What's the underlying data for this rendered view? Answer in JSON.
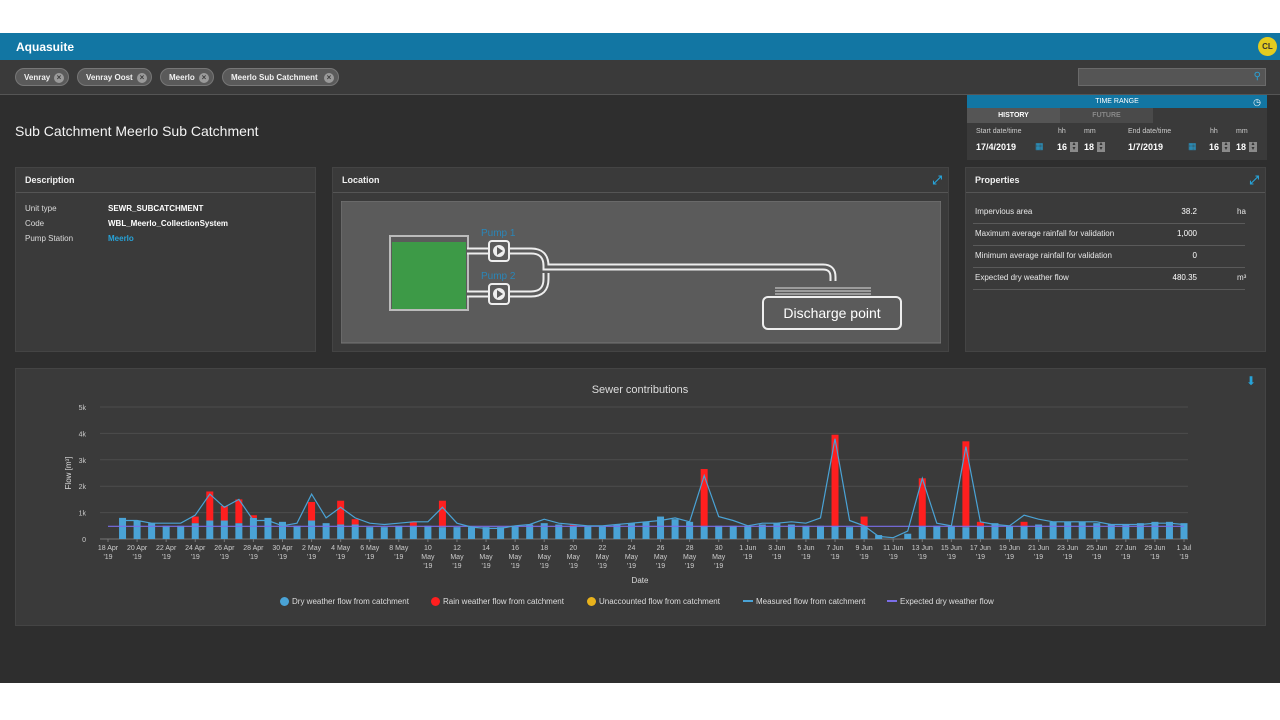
{
  "app": {
    "title": "Aquasuite",
    "user_initials": "CL"
  },
  "filters": [
    {
      "label": "Venray"
    },
    {
      "label": "Venray Oost"
    },
    {
      "label": "Meerlo"
    },
    {
      "label": "Meerlo Sub Catchment"
    }
  ],
  "search": {
    "placeholder": ""
  },
  "page": {
    "title": "Sub Catchment Meerlo Sub Catchment"
  },
  "time_range": {
    "title": "TIME RANGE",
    "tabs": [
      "HISTORY",
      "FUTURE"
    ],
    "active_tab": "HISTORY",
    "start_label": "Start date/time",
    "end_label": "End date/time",
    "hh_label": "hh",
    "mm_label": "mm",
    "start_date": "17/4/2019",
    "start_hh": "16",
    "start_mm": "18",
    "end_date": "1/7/2019",
    "end_hh": "16",
    "end_mm": "18"
  },
  "description": {
    "title": "Description",
    "rows": [
      {
        "key": "Unit type",
        "value": "SEWR_SUBCATCHMENT"
      },
      {
        "key": "Code",
        "value": "WBL_Meerlo_CollectionSystem"
      },
      {
        "key": "Pump Station",
        "value": "Meerlo"
      }
    ]
  },
  "location": {
    "title": "Location",
    "pump1": "Pump 1",
    "pump2": "Pump 2",
    "discharge": "Discharge point"
  },
  "properties": {
    "title": "Properties",
    "rows": [
      {
        "key": "Impervious area",
        "value": "38.2",
        "unit": "ha"
      },
      {
        "key": "Maximum average rainfall for validation",
        "value": "1,000",
        "unit": ""
      },
      {
        "key": "Minimum average rainfall for validation",
        "value": "0",
        "unit": ""
      },
      {
        "key": "Expected dry weather flow",
        "value": "480.35",
        "unit": "m³"
      }
    ]
  },
  "colors": {
    "accent": "#1276a3",
    "dry": "#4aa3d6",
    "rain": "#ff1f1f",
    "unaccounted": "#e8b21c",
    "measured": "#4aa3d6",
    "expected": "#7b6ee8"
  },
  "chart_data": {
    "type": "bar",
    "title": "Sewer contributions",
    "xlabel": "Date",
    "ylabel": "Flow [m³]",
    "ylim": [
      0,
      5000
    ],
    "yticks": [
      "0",
      "1k",
      "2k",
      "3k",
      "4k",
      "5k"
    ],
    "xticks": [
      [
        "18 Apr",
        "'19"
      ],
      [
        "20 Apr",
        "'19"
      ],
      [
        "22 Apr",
        "'19"
      ],
      [
        "24 Apr",
        "'19"
      ],
      [
        "26 Apr",
        "'19"
      ],
      [
        "28 Apr",
        "'19"
      ],
      [
        "30 Apr",
        "'19"
      ],
      [
        "2 May",
        "'19"
      ],
      [
        "4 May",
        "'19"
      ],
      [
        "6 May",
        "'19"
      ],
      [
        "8 May",
        "'19"
      ],
      [
        "10",
        "May",
        "'19"
      ],
      [
        "12",
        "May",
        "'19"
      ],
      [
        "14",
        "May",
        "'19"
      ],
      [
        "16",
        "May",
        "'19"
      ],
      [
        "18",
        "May",
        "'19"
      ],
      [
        "20",
        "May",
        "'19"
      ],
      [
        "22",
        "May",
        "'19"
      ],
      [
        "24",
        "May",
        "'19"
      ],
      [
        "26",
        "May",
        "'19"
      ],
      [
        "28",
        "May",
        "'19"
      ],
      [
        "30",
        "May",
        "'19"
      ],
      [
        "1 Jun",
        "'19"
      ],
      [
        "3 Jun",
        "'19"
      ],
      [
        "5 Jun",
        "'19"
      ],
      [
        "7 Jun",
        "'19"
      ],
      [
        "9 Jun",
        "'19"
      ],
      [
        "11 Jun",
        "'19"
      ],
      [
        "13 Jun",
        "'19"
      ],
      [
        "15 Jun",
        "'19"
      ],
      [
        "17 Jun",
        "'19"
      ],
      [
        "19 Jun",
        "'19"
      ],
      [
        "21 Jun",
        "'19"
      ],
      [
        "23 Jun",
        "'19"
      ],
      [
        "25 Jun",
        "'19"
      ],
      [
        "27 Jun",
        "'19"
      ],
      [
        "29 Jun",
        "'19"
      ],
      [
        "1 Jul",
        "'19"
      ]
    ],
    "categories": [
      "18 Apr",
      "19 Apr",
      "20 Apr",
      "21 Apr",
      "22 Apr",
      "23 Apr",
      "24 Apr",
      "25 Apr",
      "26 Apr",
      "27 Apr",
      "28 Apr",
      "29 Apr",
      "30 Apr",
      "1 May",
      "2 May",
      "3 May",
      "4 May",
      "5 May",
      "6 May",
      "7 May",
      "8 May",
      "9 May",
      "10 May",
      "11 May",
      "12 May",
      "13 May",
      "14 May",
      "15 May",
      "16 May",
      "17 May",
      "18 May",
      "19 May",
      "20 May",
      "21 May",
      "22 May",
      "23 May",
      "24 May",
      "25 May",
      "26 May",
      "27 May",
      "28 May",
      "29 May",
      "30 May",
      "31 May",
      "1 Jun",
      "2 Jun",
      "3 Jun",
      "4 Jun",
      "5 Jun",
      "6 Jun",
      "7 Jun",
      "8 Jun",
      "9 Jun",
      "10 Jun",
      "11 Jun",
      "12 Jun",
      "13 Jun",
      "14 Jun",
      "15 Jun",
      "16 Jun",
      "17 Jun",
      "18 Jun",
      "19 Jun",
      "20 Jun",
      "21 Jun",
      "22 Jun",
      "23 Jun",
      "24 Jun",
      "25 Jun",
      "26 Jun",
      "27 Jun",
      "28 Jun",
      "29 Jun",
      "30 Jun",
      "1 Jul"
    ],
    "series": [
      {
        "name": "Dry weather flow from catchment",
        "values": [
          0,
          800,
          700,
          600,
          500,
          500,
          600,
          700,
          700,
          600,
          800,
          800,
          650,
          500,
          700,
          600,
          550,
          550,
          450,
          450,
          500,
          500,
          500,
          450,
          450,
          450,
          450,
          450,
          500,
          550,
          600,
          550,
          500,
          500,
          500,
          550,
          600,
          650,
          850,
          750,
          650,
          500,
          500,
          500,
          500,
          550,
          600,
          550,
          500,
          500,
          500,
          450,
          500,
          150,
          0,
          200,
          500,
          500,
          500,
          450,
          500,
          600,
          500,
          500,
          550,
          650,
          650,
          650,
          600,
          550,
          550,
          600,
          650,
          650,
          600
        ]
      },
      {
        "name": "Rain weather flow from catchment",
        "values": [
          0,
          0,
          0,
          0,
          0,
          0,
          250,
          1100,
          550,
          900,
          100,
          0,
          0,
          0,
          700,
          0,
          900,
          200,
          0,
          0,
          0,
          150,
          0,
          1000,
          0,
          0,
          0,
          0,
          0,
          0,
          0,
          0,
          50,
          0,
          0,
          0,
          0,
          0,
          0,
          0,
          0,
          2150,
          0,
          0,
          0,
          0,
          0,
          0,
          0,
          0,
          3450,
          0,
          350,
          0,
          0,
          0,
          1800,
          0,
          0,
          3250,
          150,
          0,
          0,
          150,
          0,
          0,
          0,
          0,
          0,
          0,
          0,
          0,
          0,
          0,
          0
        ]
      },
      {
        "name": "Unaccounted flow from catchment",
        "values": [
          0,
          0,
          0,
          0,
          0,
          0,
          0,
          0,
          0,
          0,
          0,
          0,
          0,
          0,
          0,
          0,
          0,
          0,
          0,
          0,
          0,
          0,
          0,
          0,
          0,
          0,
          0,
          0,
          0,
          0,
          0,
          0,
          0,
          0,
          0,
          0,
          0,
          0,
          0,
          0,
          0,
          0,
          0,
          0,
          0,
          0,
          0,
          0,
          0,
          0,
          0,
          0,
          0,
          0,
          0,
          0,
          0,
          0,
          0,
          0,
          0,
          0,
          0,
          0,
          0,
          0,
          0,
          0,
          0,
          0,
          0,
          0,
          0,
          0,
          0
        ]
      },
      {
        "name": "Measured flow from catchment",
        "values": [
          null,
          700,
          700,
          600,
          600,
          600,
          900,
          1700,
          1200,
          1500,
          700,
          700,
          500,
          600,
          1700,
          800,
          1200,
          800,
          600,
          550,
          600,
          650,
          650,
          1200,
          600,
          450,
          400,
          400,
          500,
          550,
          750,
          600,
          550,
          500,
          500,
          550,
          600,
          650,
          700,
          800,
          650,
          2400,
          850,
          700,
          500,
          600,
          600,
          650,
          600,
          800,
          3800,
          700,
          500,
          100,
          50,
          300,
          2300,
          600,
          500,
          3500,
          650,
          550,
          500,
          900,
          750,
          650,
          650,
          650,
          650,
          550,
          550,
          550,
          600,
          600,
          550
        ]
      },
      {
        "name": "Expected dry weather flow",
        "values": [
          480.35,
          480.35
        ]
      }
    ]
  }
}
